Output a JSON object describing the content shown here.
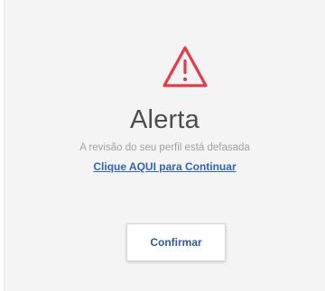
{
  "dialog": {
    "icon": "warning-triangle-icon",
    "accent_color": "#e23b4c",
    "title": "Alerta",
    "message": "A revisão do seu perfil está defasada",
    "link_label": "Clique AQUI para Continuar",
    "confirm_label": "Confirmar"
  }
}
